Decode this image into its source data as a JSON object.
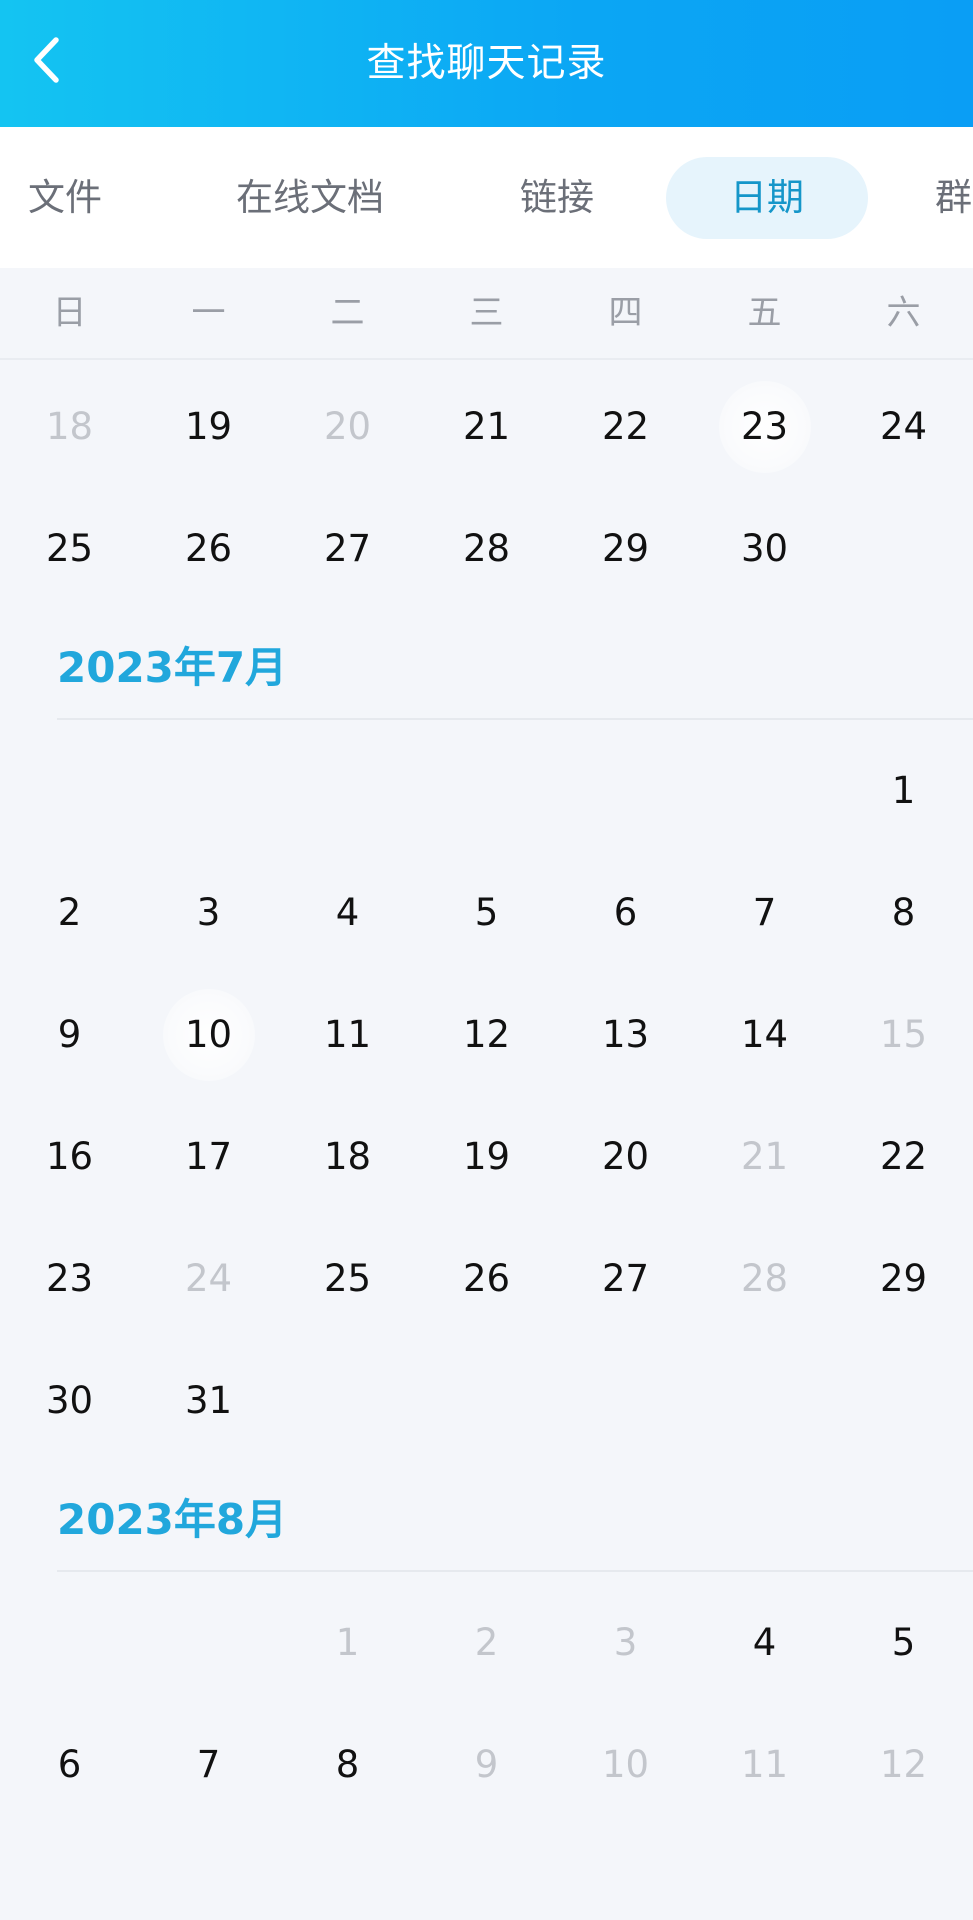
{
  "header": {
    "title": "查找聊天记录",
    "back_icon": "chevron-left-icon"
  },
  "tabs": [
    {
      "label": "文件",
      "active": false
    },
    {
      "label": "在线文档",
      "active": false
    },
    {
      "label": "链接",
      "active": false
    },
    {
      "label": "日期",
      "active": true
    },
    {
      "label": "群",
      "active": false
    }
  ],
  "weekdays": [
    "日",
    "一",
    "二",
    "三",
    "四",
    "五",
    "六"
  ],
  "calendar": {
    "june_rows": [
      [
        {
          "d": "18",
          "disabled": true
        },
        {
          "d": "19"
        },
        {
          "d": "20",
          "disabled": true
        },
        {
          "d": "21"
        },
        {
          "d": "22"
        },
        {
          "d": "23",
          "highlight": true
        },
        {
          "d": "24"
        }
      ],
      [
        {
          "d": "25"
        },
        {
          "d": "26"
        },
        {
          "d": "27"
        },
        {
          "d": "28"
        },
        {
          "d": "29"
        },
        {
          "d": "30"
        },
        null
      ]
    ],
    "months": [
      {
        "title": "2023年7月",
        "rows": [
          [
            null,
            null,
            null,
            null,
            null,
            null,
            {
              "d": "1"
            }
          ],
          [
            {
              "d": "2"
            },
            {
              "d": "3"
            },
            {
              "d": "4"
            },
            {
              "d": "5"
            },
            {
              "d": "6"
            },
            {
              "d": "7"
            },
            {
              "d": "8"
            }
          ],
          [
            {
              "d": "9"
            },
            {
              "d": "10",
              "highlight": true
            },
            {
              "d": "11"
            },
            {
              "d": "12"
            },
            {
              "d": "13"
            },
            {
              "d": "14"
            },
            {
              "d": "15",
              "disabled": true
            }
          ],
          [
            {
              "d": "16"
            },
            {
              "d": "17"
            },
            {
              "d": "18"
            },
            {
              "d": "19"
            },
            {
              "d": "20"
            },
            {
              "d": "21",
              "disabled": true
            },
            {
              "d": "22"
            }
          ],
          [
            {
              "d": "23"
            },
            {
              "d": "24",
              "disabled": true
            },
            {
              "d": "25"
            },
            {
              "d": "26"
            },
            {
              "d": "27"
            },
            {
              "d": "28",
              "disabled": true
            },
            {
              "d": "29"
            }
          ],
          [
            {
              "d": "30"
            },
            {
              "d": "31"
            },
            null,
            null,
            null,
            null,
            null
          ]
        ]
      },
      {
        "title": "2023年8月",
        "rows": [
          [
            null,
            null,
            {
              "d": "1",
              "disabled": true
            },
            {
              "d": "2",
              "disabled": true
            },
            {
              "d": "3",
              "disabled": true
            },
            {
              "d": "4"
            },
            {
              "d": "5"
            }
          ],
          [
            {
              "d": "6"
            },
            {
              "d": "7"
            },
            {
              "d": "8"
            },
            {
              "d": "9",
              "disabled": true
            },
            {
              "d": "10",
              "disabled": true
            },
            {
              "d": "11",
              "disabled": true
            },
            {
              "d": "12",
              "disabled": true
            }
          ]
        ]
      }
    ]
  },
  "colors": {
    "accent": "#21a7dc",
    "header_gradient_start": "#14c4f2",
    "header_gradient_end": "#0a9ef5",
    "active_tab_pill": "#e6f4fc",
    "disabled_text": "#c3c6cc"
  }
}
